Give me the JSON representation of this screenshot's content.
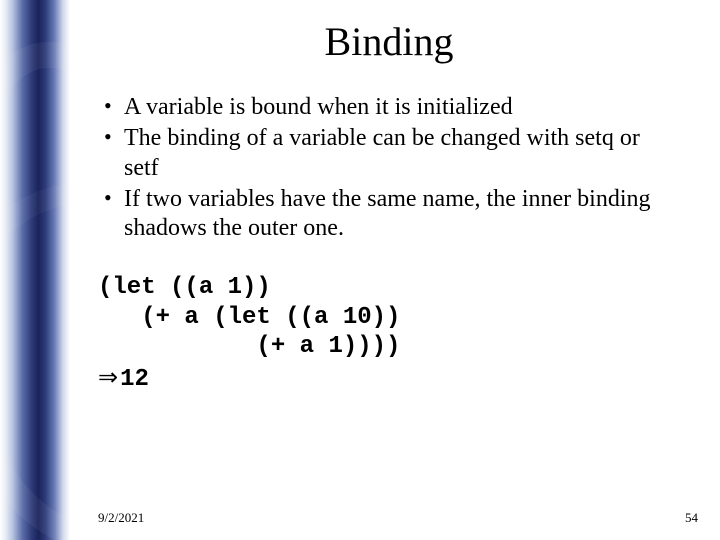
{
  "title": "Binding",
  "bullets": [
    " A variable is bound when it is initialized",
    "The binding of a variable can be changed with setq or setf",
    "If two variables have the same name, the inner binding shadows the outer one."
  ],
  "code": "(let ((a 1))\n   (+ a (let ((a 10))\n           (+ a 1))))",
  "result_arrow": "⇒",
  "result_value": "12",
  "footer": {
    "date": "9/2/2021",
    "page": "54"
  }
}
